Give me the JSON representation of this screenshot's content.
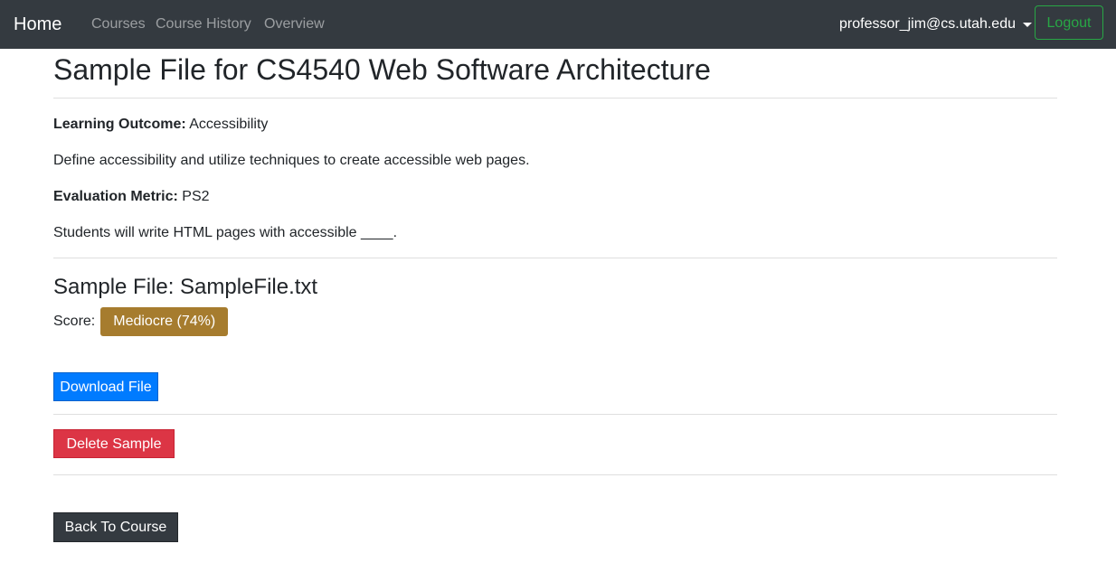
{
  "navbar": {
    "brand": "Home",
    "links": [
      "Courses",
      "Course History",
      "Overview"
    ],
    "user": "professor_jim@cs.utah.edu",
    "logout_label": "Logout",
    "background": "#343a40"
  },
  "page": {
    "title": "Sample File for CS4540 Web Software Architecture",
    "learning_outcome_label": "Learning Outcome:",
    "learning_outcome_value": "Accessibility",
    "learning_outcome_description": "Define accessibility and utilize techniques to create accessible web pages.",
    "evaluation_metric_label": "Evaluation Metric:",
    "evaluation_metric_value": "PS2",
    "evaluation_metric_description": "Students will write HTML pages with accessible ____.",
    "sample_file_heading": "Sample File: SampleFile.txt",
    "score_label": "Score:",
    "score_badge": "Mediocre (74%)",
    "score_color": "#a67c2e"
  },
  "actions": {
    "download_label": "Download File",
    "delete_label": "Delete Sample",
    "back_label": "Back To Course",
    "colors": {
      "primary": "#007bff",
      "danger": "#dc3545",
      "dark": "#343a40",
      "success": "#28a745"
    }
  }
}
